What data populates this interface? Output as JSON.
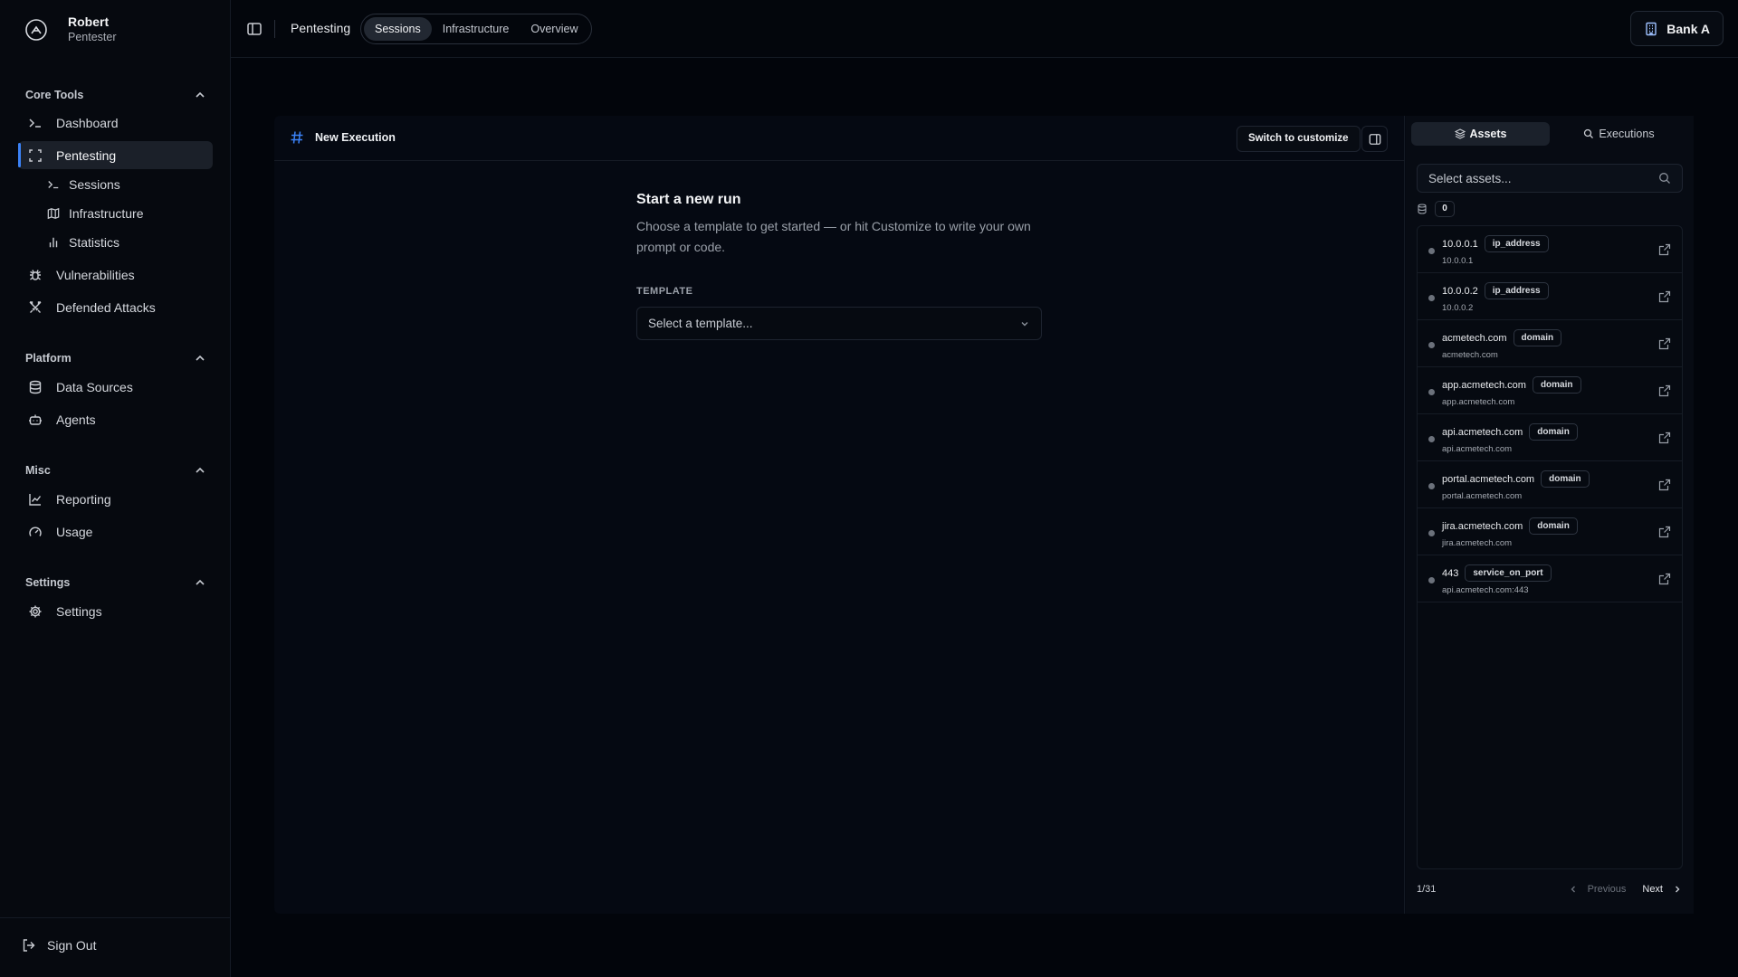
{
  "user": {
    "name": "Robert",
    "role": "Pentester"
  },
  "sidebar": {
    "sections": [
      {
        "title": "Core Tools"
      },
      {
        "title": "Platform"
      },
      {
        "title": "Misc"
      },
      {
        "title": "Settings"
      }
    ],
    "items": {
      "dashboard": "Dashboard",
      "pentesting": "Pentesting",
      "sessions": "Sessions",
      "infrastructure": "Infrastructure",
      "statistics": "Statistics",
      "vulnerabilities": "Vulnerabilities",
      "defended_attacks": "Defended Attacks",
      "data_sources": "Data Sources",
      "agents": "Agents",
      "reporting": "Reporting",
      "usage": "Usage",
      "settings": "Settings"
    },
    "sign_out": "Sign Out",
    "accent_color": "#3b82f6"
  },
  "topbar": {
    "crumb": "Pentesting",
    "tabs": [
      "Sessions",
      "Infrastructure",
      "Overview"
    ],
    "active_tab": "Sessions",
    "org": "Bank A"
  },
  "execution": {
    "title": "New Execution",
    "switch_label": "Switch to customize",
    "heading": "Start a new run",
    "description": "Choose a template to get started — or hit Customize to write your own prompt or code.",
    "template_label": "TEMPLATE",
    "template_placeholder": "Select a template..."
  },
  "assets_panel": {
    "tabs": [
      "Assets",
      "Executions"
    ],
    "active_tab": "Assets",
    "search_placeholder": "Select assets...",
    "selected_count": "0",
    "items": [
      {
        "name": "10.0.0.1",
        "type": "ip_address",
        "value": "10.0.0.1"
      },
      {
        "name": "10.0.0.2",
        "type": "ip_address",
        "value": "10.0.0.2"
      },
      {
        "name": "acmetech.com",
        "type": "domain",
        "value": "acmetech.com"
      },
      {
        "name": "app.acmetech.com",
        "type": "domain",
        "value": "app.acmetech.com"
      },
      {
        "name": "api.acmetech.com",
        "type": "domain",
        "value": "api.acmetech.com"
      },
      {
        "name": "portal.acmetech.com",
        "type": "domain",
        "value": "portal.acmetech.com"
      },
      {
        "name": "jira.acmetech.com",
        "type": "domain",
        "value": "jira.acmetech.com"
      },
      {
        "name": "443",
        "type": "service_on_port",
        "value": "api.acmetech.com:443"
      }
    ],
    "page": "1/31",
    "prev_label": "Previous",
    "next_label": "Next"
  }
}
